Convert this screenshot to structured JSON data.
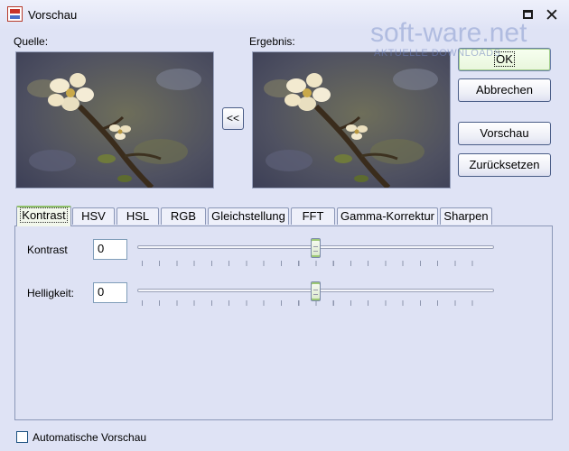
{
  "window": {
    "title": "Vorschau"
  },
  "titlebar_icons": {
    "app": "raw-app-icon",
    "maximize": "maximize-icon",
    "close": "close-icon"
  },
  "source": {
    "label": "Quelle:"
  },
  "result": {
    "label": "Ergebnis:"
  },
  "copy_button": {
    "label": "<<"
  },
  "buttons": {
    "ok": "OK",
    "cancel": "Abbrechen",
    "preview": "Vorschau",
    "reset": "Zurücksetzen"
  },
  "watermark": {
    "main": "soft-ware.net",
    "sub": "AKTUELLE DOWNLOADS"
  },
  "tabs": [
    "Kontrast",
    "HSV",
    "HSL",
    "RGB",
    "Gleichstellung",
    "FFT",
    "Gamma-Korrektur",
    "Sharpen"
  ],
  "active_tab": "Kontrast",
  "controls": {
    "contrast": {
      "label": "Kontrast",
      "value": "0",
      "position": 0.5
    },
    "brightness": {
      "label": "Helligkeit:",
      "value": "0",
      "position": 0.5
    }
  },
  "auto_preview": {
    "label": "Automatische Vorschau",
    "checked": false
  },
  "colors": {
    "accent_green": "#8fc06b",
    "border": "#4a5d87",
    "panel": "#dee2f4"
  }
}
